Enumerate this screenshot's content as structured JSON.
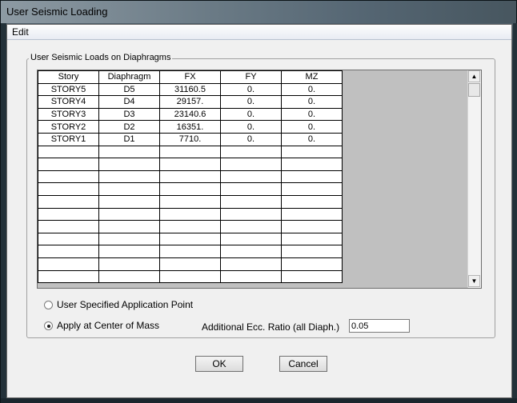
{
  "window": {
    "title": "User Seismic Loading"
  },
  "menu": {
    "edit": "Edit"
  },
  "group": {
    "label": "User Seismic Loads on Diaphragms"
  },
  "grid": {
    "headers": [
      "Story",
      "Diaphragm",
      "FX",
      "FY",
      "MZ"
    ],
    "rows": [
      [
        "STORY5",
        "D5",
        "31160.5",
        "0.",
        "0."
      ],
      [
        "STORY4",
        "D4",
        "29157.",
        "0.",
        "0."
      ],
      [
        "STORY3",
        "D3",
        "23140.6",
        "0.",
        "0."
      ],
      [
        "STORY2",
        "D2",
        "16351.",
        "0.",
        "0."
      ],
      [
        "STORY1",
        "D1",
        "7710.",
        "0.",
        "0."
      ]
    ]
  },
  "options": {
    "user_specified": "User Specified Application Point",
    "center_of_mass": "Apply at Center of Mass",
    "selected": "center_of_mass"
  },
  "ecc": {
    "label": "Additional Ecc. Ratio (all Diaph.)",
    "value": "0.05"
  },
  "buttons": {
    "ok": "OK",
    "cancel": "Cancel"
  },
  "scroll": {
    "up_icon": "▲",
    "down_icon": "▼"
  }
}
